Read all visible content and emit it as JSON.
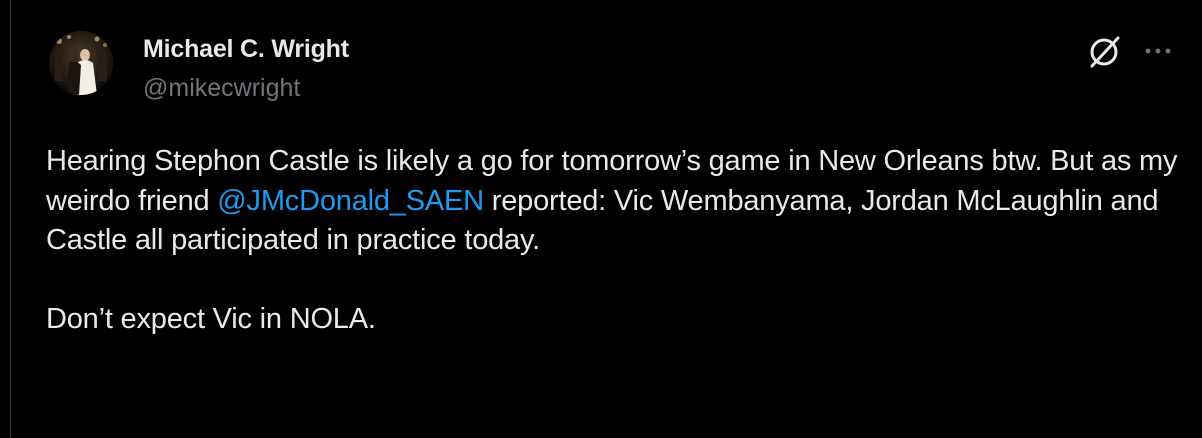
{
  "tweet": {
    "author": {
      "display_name": "Michael C. Wright",
      "handle": "@mikecwright"
    },
    "body": {
      "para1_before_mention": "Hearing Stephon Castle is likely a go for tomorrow’s game in New Orleans btw. But as my weirdo friend ",
      "mention": "@JMcDonald_SAEN",
      "para1_after_mention": " reported: Vic Wembanyama, Jordan McLaughlin and Castle all participated in practice today.",
      "para2": "Don’t expect Vic in NOLA."
    },
    "actions": {
      "grok_icon": "grok-icon",
      "more_icon": "more-options-icon"
    }
  },
  "colors": {
    "background": "#000000",
    "text": "#e7e9ea",
    "secondary_text": "#71767b",
    "link": "#1d9bf0"
  }
}
